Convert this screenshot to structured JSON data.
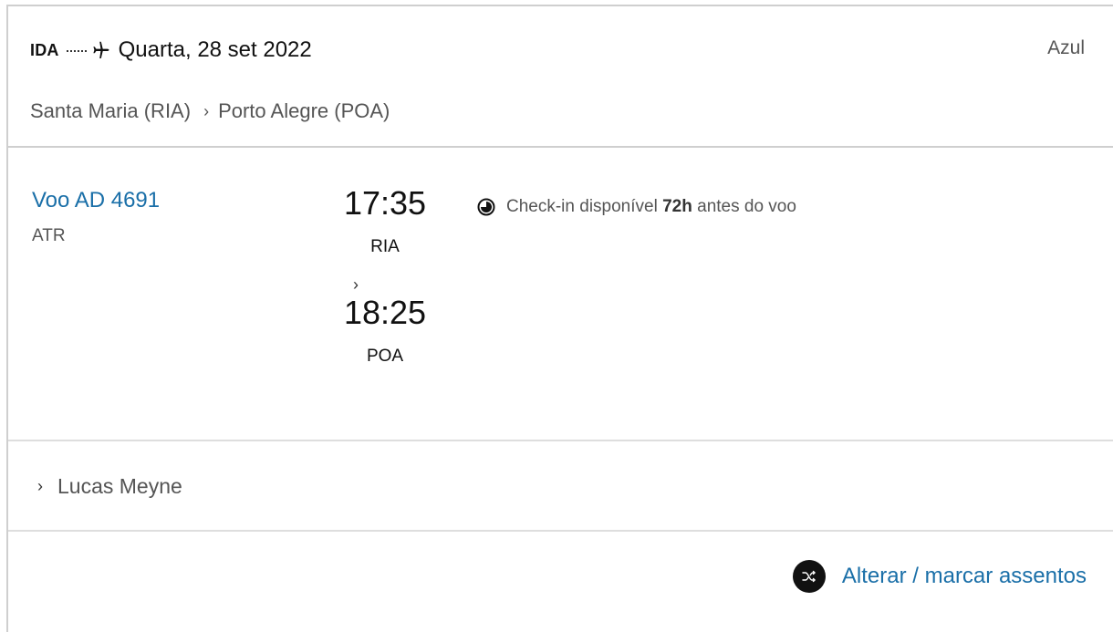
{
  "header": {
    "direction_label": "IDA",
    "date": "Quarta, 28 set 2022",
    "airline": "Azul",
    "origin": "Santa Maria (RIA)",
    "destination": "Porto Alegre (POA)"
  },
  "flight": {
    "number": "Voo AD 4691",
    "aircraft": "ATR",
    "departure_time": "17:35",
    "departure_code": "RIA",
    "arrival_time": "18:25",
    "arrival_code": "POA",
    "checkin_prefix": "Check-in disponível",
    "checkin_hours": "72h",
    "checkin_suffix": "antes do voo"
  },
  "passenger": {
    "name": "Lucas Meyne"
  },
  "actions": {
    "seat_label": "Alterar / marcar assentos"
  },
  "icons": [
    "plane-icon",
    "clock-icon",
    "chevron-right-icon",
    "shuffle-icon"
  ],
  "colors": {
    "link": "#1a6fa8",
    "border": "#cfcfcf",
    "icon_bg": "#111111"
  }
}
